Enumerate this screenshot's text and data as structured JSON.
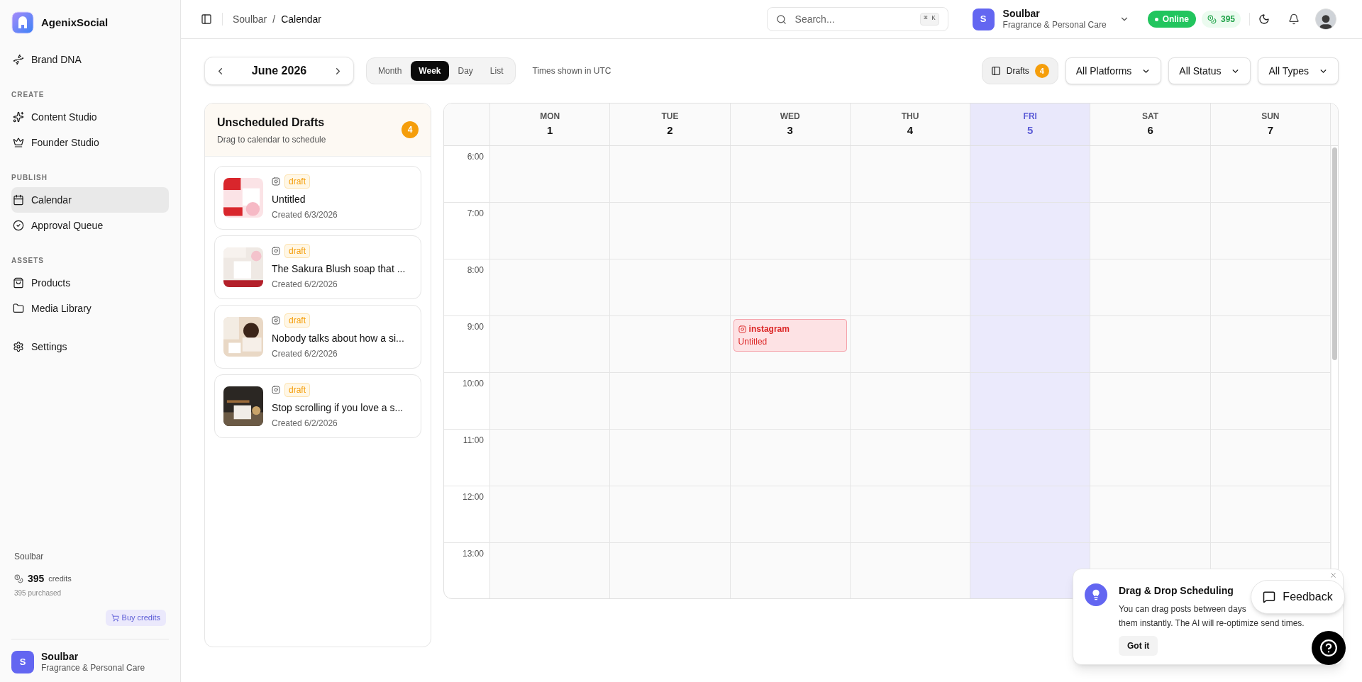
{
  "sidebar": {
    "brand": "AgenixSocial",
    "sections": [
      {
        "items": [
          {
            "label": "Brand DNA",
            "selected": false
          }
        ]
      },
      {
        "heading": "CREATE",
        "items": [
          {
            "label": "Content Studio",
            "selected": false
          },
          {
            "label": "Founder Studio",
            "selected": false
          }
        ]
      },
      {
        "heading": "PUBLISH",
        "items": [
          {
            "label": "Calendar",
            "selected": true
          },
          {
            "label": "Approval Queue",
            "selected": false
          }
        ]
      },
      {
        "heading": "ASSETS",
        "items": [
          {
            "label": "Products",
            "selected": false
          },
          {
            "label": "Media Library",
            "selected": false
          }
        ]
      },
      {
        "items": [
          {
            "label": "Settings",
            "selected": false
          }
        ]
      }
    ],
    "workspace": "Soulbar",
    "credits": "395",
    "credits_label": "credits",
    "purchased": "395 purchased",
    "buy_button": "Buy credits",
    "profile": {
      "initial": "S",
      "name": "Soulbar",
      "subtitle": "Fragrance & Personal Care"
    }
  },
  "topbar": {
    "breadcrumb": [
      "Soulbar",
      "/",
      "Calendar"
    ],
    "search": {
      "placeholder": "Search...",
      "shortcut": "⌘ K"
    },
    "account": {
      "initial": "S",
      "name": "Soulbar",
      "subtitle": "Fragrance & Personal Care"
    },
    "status": "Online",
    "credits": "395"
  },
  "toolbar": {
    "month": "June 2026",
    "views": [
      {
        "label": "Month",
        "selected": false
      },
      {
        "label": "Week",
        "selected": true
      },
      {
        "label": "Day",
        "selected": false
      },
      {
        "label": "List",
        "selected": false
      }
    ],
    "timezone_note": "Times shown in UTC",
    "drafts_button": "Drafts",
    "drafts_count": "4",
    "filters": [
      "All Platforms",
      "All Status",
      "All Types"
    ]
  },
  "drafts_panel": {
    "title": "Unscheduled Drafts",
    "subtitle": "Drag to calendar to schedule",
    "count": "4",
    "drafts": [
      {
        "status": "draft",
        "title": "Untitled",
        "created": "Created 6/3/2026"
      },
      {
        "status": "draft",
        "title": "The Sakura Blush soap that ...",
        "created": "Created 6/2/2026"
      },
      {
        "status": "draft",
        "title": "Nobody talks about how a si...",
        "created": "Created 6/2/2026"
      },
      {
        "status": "draft",
        "title": "Stop scrolling if you love a s...",
        "created": "Created 6/2/2026"
      }
    ]
  },
  "calendar": {
    "hours": [
      "6:00",
      "7:00",
      "8:00",
      "9:00",
      "10:00",
      "11:00",
      "12:00",
      "13:00"
    ],
    "days": [
      {
        "dow": "MON",
        "date": "1",
        "selected": false,
        "slots": [
          {
            "booked": false
          },
          {
            "booked": false
          },
          {
            "booked": false
          },
          {
            "booked": false
          },
          {
            "booked": false
          },
          {
            "booked": false
          },
          {
            "booked": false
          },
          {
            "booked": false
          }
        ]
      },
      {
        "dow": "TUE",
        "date": "2",
        "selected": false,
        "slots": [
          {
            "booked": false
          },
          {
            "booked": false
          },
          {
            "booked": false
          },
          {
            "booked": false
          },
          {
            "booked": false
          },
          {
            "booked": false
          },
          {
            "booked": false
          },
          {
            "booked": false
          }
        ]
      },
      {
        "dow": "WED",
        "date": "3",
        "selected": false,
        "slots": [
          {
            "booked": false
          },
          {
            "booked": false
          },
          {
            "booked": false
          },
          {
            "booked": true,
            "platform": "instagram",
            "title": "Untitled"
          },
          {
            "booked": false
          },
          {
            "booked": false
          },
          {
            "booked": false
          },
          {
            "booked": false
          }
        ]
      },
      {
        "dow": "THU",
        "date": "4",
        "selected": false,
        "slots": [
          {
            "booked": false
          },
          {
            "booked": false
          },
          {
            "booked": false
          },
          {
            "booked": false
          },
          {
            "booked": false
          },
          {
            "booked": false
          },
          {
            "booked": false
          },
          {
            "booked": false
          }
        ]
      },
      {
        "dow": "FRI",
        "date": "5",
        "selected": true,
        "slots": [
          {
            "booked": false
          },
          {
            "booked": false
          },
          {
            "booked": false
          },
          {
            "booked": false
          },
          {
            "booked": false
          },
          {
            "booked": false
          },
          {
            "booked": false
          },
          {
            "booked": false
          }
        ]
      },
      {
        "dow": "SAT",
        "date": "6",
        "selected": false,
        "slots": [
          {
            "booked": false
          },
          {
            "booked": false
          },
          {
            "booked": false
          },
          {
            "booked": false
          },
          {
            "booked": false
          },
          {
            "booked": false
          },
          {
            "booked": false
          },
          {
            "booked": false
          }
        ]
      },
      {
        "dow": "SUN",
        "date": "7",
        "selected": false,
        "slots": [
          {
            "booked": false
          },
          {
            "booked": false
          },
          {
            "booked": false
          },
          {
            "booked": false
          },
          {
            "booked": false
          },
          {
            "booked": false
          },
          {
            "booked": false
          },
          {
            "booked": false
          }
        ]
      }
    ]
  },
  "tip": {
    "title": "Drag & Drop Scheduling",
    "body": [
      "You can drag posts between days",
      "them instantly. The AI will re-optimize send times."
    ],
    "button": "Got it"
  },
  "feedback_button": "Feedback"
}
